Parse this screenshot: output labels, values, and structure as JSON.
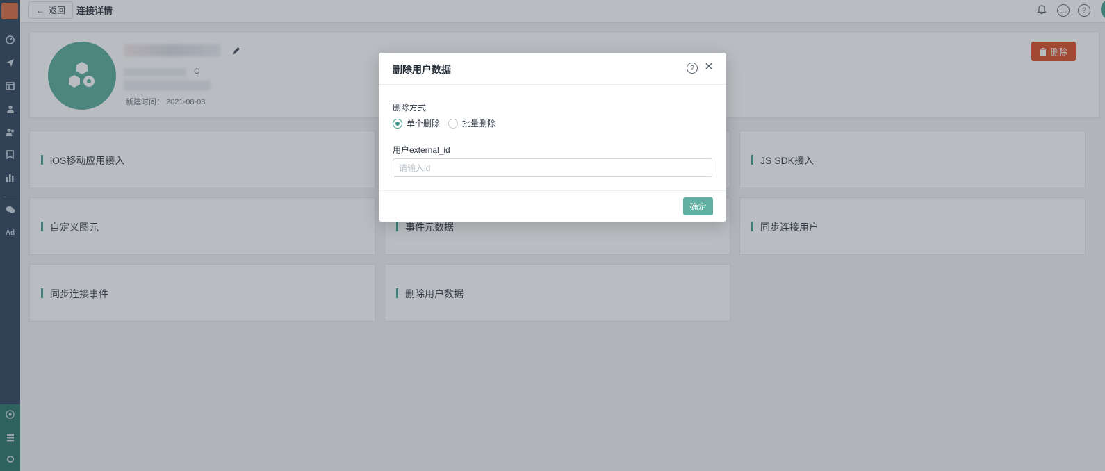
{
  "sidebar": {
    "icons": [
      "dashboard-icon",
      "send-icon",
      "layout-icon",
      "user-icon",
      "users-icon",
      "bookmark-icon",
      "bar-chart-icon",
      "chat-icon"
    ],
    "ad_label": "Ad",
    "bottom_icons": [
      "connect-icon",
      "list-icon",
      "settings-icon"
    ]
  },
  "topbar": {
    "back_label": "返回",
    "title": "连接详情",
    "icons": [
      "bell-icon",
      "message-icon",
      "help-icon",
      "avatar-icon"
    ]
  },
  "info": {
    "name_suffix": "C",
    "created_label": "新建时间：",
    "created_date": "2021-08-03",
    "delete_label": "删除"
  },
  "tiles": [
    {
      "label": "iOS移动应用接入"
    },
    {
      "label": "JS SDK接入"
    },
    {
      "label": "自定义图元"
    },
    {
      "label": "事件元数据"
    },
    {
      "label": "同步连接用户"
    },
    {
      "label": "同步连接事件"
    },
    {
      "label": "删除用户数据"
    }
  ],
  "modal": {
    "title": "删除用户数据",
    "method_label": "删除方式",
    "options": [
      {
        "label": "单个删除",
        "selected": true
      },
      {
        "label": "批量删除",
        "selected": false
      }
    ],
    "id_label": "用户external_id",
    "id_placeholder": "请输入id",
    "id_value": "",
    "confirm_label": "确定"
  },
  "colors": {
    "accent": "#3e9b8c",
    "danger": "#d9461c",
    "sidebar": "#243b55"
  }
}
